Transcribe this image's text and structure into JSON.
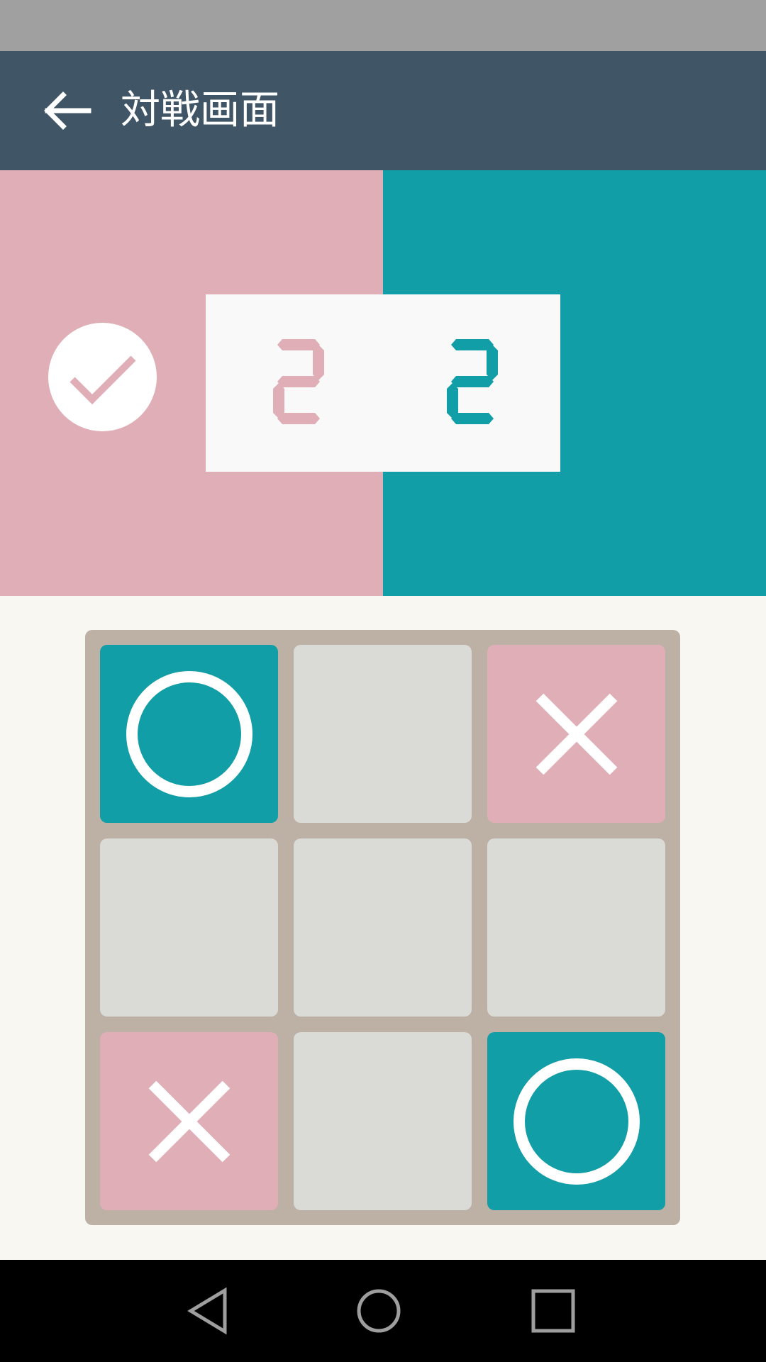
{
  "app_bar": {
    "title": "対戦画面",
    "back_icon": "arrow-back-icon"
  },
  "scoreboard": {
    "turn_icon": "check-circle-icon",
    "score_pink": "2",
    "score_teal": "2",
    "colors": {
      "pink": "#e0aeb6",
      "teal": "#129ea6"
    }
  },
  "board": {
    "cells": [
      "O",
      "",
      "X",
      "",
      "",
      "",
      "X",
      "",
      "O"
    ]
  },
  "nav": {
    "back_icon": "nav-back-icon",
    "home_icon": "nav-home-icon",
    "recents_icon": "nav-recents-icon"
  }
}
